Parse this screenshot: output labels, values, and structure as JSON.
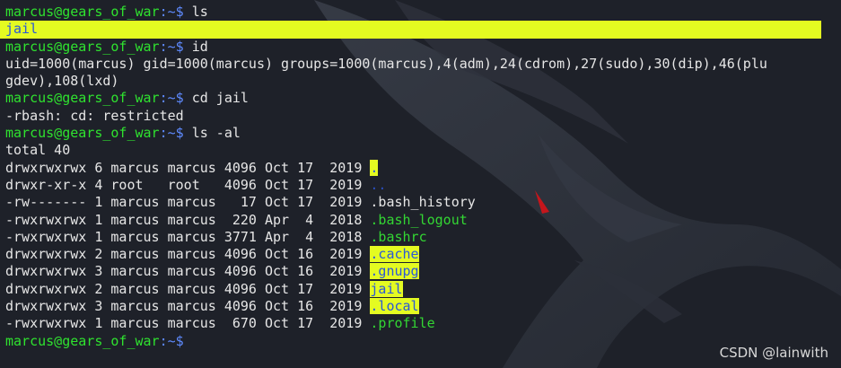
{
  "terminal": {
    "user": "marcus@gears_of_war",
    "sep": ":~$",
    "commands": {
      "ls": "ls",
      "id": "id",
      "cd": "cd jail",
      "lsal": "ls -al"
    },
    "ls_output": "jail",
    "id_output_1": "uid=1000(marcus) gid=1000(marcus) groups=1000(marcus),4(adm),24(cdrom),27(sudo),30(dip),46(plu",
    "id_output_2": "gdev),108(lxd)",
    "cd_output": "-rbash: cd: restricted",
    "total": "total 40",
    "listing": [
      {
        "meta": "drwxrwxrwx 6 marcus marcus 4096 Oct 17  2019 ",
        "name": "."
      },
      {
        "meta": "drwxr-xr-x 4 root   root   4096 Oct 17  2019 ",
        "name": ".."
      },
      {
        "meta": "-rw------- 1 marcus marcus   17 Oct 17  2019 ",
        "name": ".bash_history"
      },
      {
        "meta": "-rwxrwxrwx 1 marcus marcus  220 Apr  4  2018 ",
        "name": ".bash_logout"
      },
      {
        "meta": "-rwxrwxrwx 1 marcus marcus 3771 Apr  4  2018 ",
        "name": ".bashrc"
      },
      {
        "meta": "drwxrwxrwx 2 marcus marcus 4096 Oct 16  2019 ",
        "name": ".cache"
      },
      {
        "meta": "drwxrwxrwx 3 marcus marcus 4096 Oct 16  2019 ",
        "name": ".gnupg"
      },
      {
        "meta": "drwxrwxrwx 2 marcus marcus 4096 Oct 17  2019 ",
        "name": "jail"
      },
      {
        "meta": "drwxrwxrwx 3 marcus marcus 4096 Oct 16  2019 ",
        "name": ".local"
      },
      {
        "meta": "-rwxrwxrwx 1 marcus marcus  670 Oct 17  2019 ",
        "name": ".profile"
      }
    ]
  },
  "watermark": "CSDN @lainwith",
  "colors": {
    "background": "#1e2129",
    "user": "#2fe22f",
    "path": "#5f8bff",
    "highlight": "#e4fb21",
    "highlight_text": "#2a58d8"
  }
}
